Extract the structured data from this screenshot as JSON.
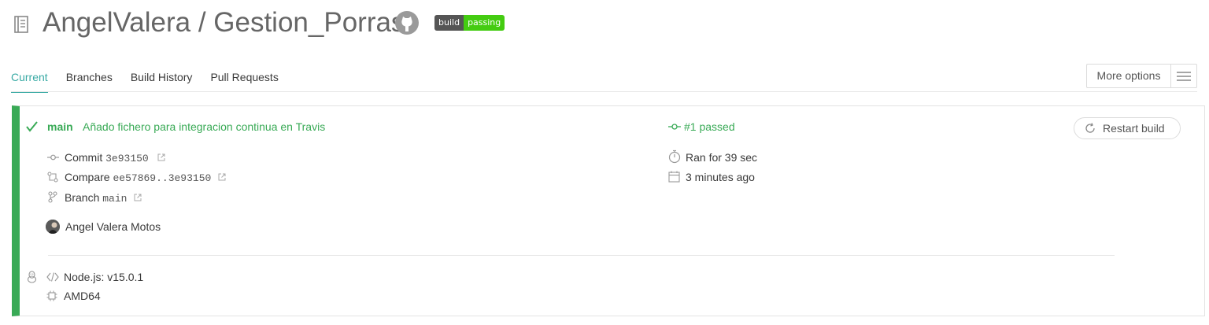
{
  "header": {
    "repo_title": "AngelValera / Gestion_Porras",
    "badge_left": "build",
    "badge_right": "passing"
  },
  "tabs": [
    {
      "label": "Current",
      "active": true
    },
    {
      "label": "Branches",
      "active": false
    },
    {
      "label": "Build History",
      "active": false
    },
    {
      "label": "Pull Requests",
      "active": false
    }
  ],
  "more_options": "More options",
  "build": {
    "branch": "main",
    "message": "Añado fichero para integracion continua en Travis",
    "number_status": "#1 passed",
    "restart_label": "Restart build",
    "commit_label": "Commit",
    "commit_hash": "3e93150",
    "compare_label": "Compare",
    "compare_range": "ee57869..3e93150",
    "branch_label": "Branch",
    "branch_name": "main",
    "duration": "Ran for 39 sec",
    "finished": "3 minutes ago",
    "author": "Angel Valera Motos",
    "language": "Node.js: v15.0.1",
    "arch": "AMD64"
  },
  "colors": {
    "passed": "#39aa56",
    "tab_active": "#39aaa4"
  },
  "icons": [
    "repo-icon",
    "github-icon",
    "check-icon",
    "commit-icon",
    "compare-icon",
    "branch-icon",
    "external-link-icon",
    "stopwatch-icon",
    "calendar-icon",
    "restart-icon",
    "linux-icon",
    "code-icon",
    "cpu-icon",
    "hamburger-icon"
  ]
}
